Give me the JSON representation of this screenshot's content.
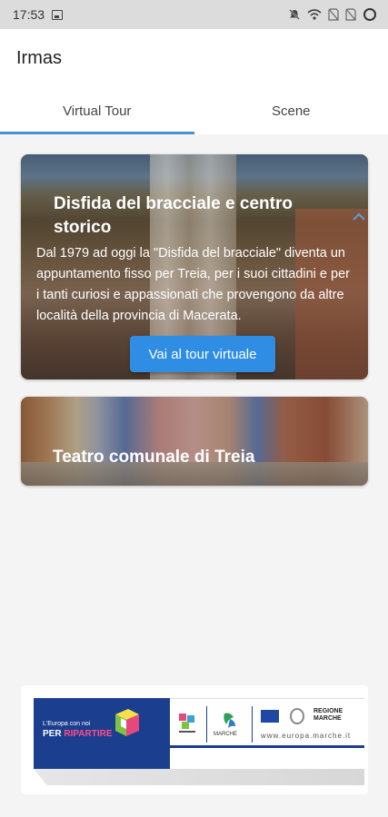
{
  "status_bar": {
    "time": "17:53",
    "icons": [
      "image-icon",
      "mute-icon",
      "hotspot-icon",
      "no-sim-icon",
      "no-sim-icon",
      "battery-ring-icon"
    ]
  },
  "app_bar": {
    "title": "Irmas"
  },
  "tabs": [
    {
      "label": "Virtual Tour",
      "active": true
    },
    {
      "label": "Scene",
      "active": false
    }
  ],
  "cards": [
    {
      "title": "Disfida del bracciale e centro storico",
      "description": "Dal 1979 ad oggi la \"Disfida del bracciale\" diventa un appuntamento fisso per Treia, per i suoi cittadini e per i tanti curiosi e appassionati che provengono da altre località della provincia di Macerata.",
      "button_label": "Vai al tour virtuale",
      "expanded": true
    },
    {
      "title": "Teatro comunale di Treia",
      "expanded": false
    }
  ],
  "banner": {
    "slogan_small": "L'Europa con noi",
    "slogan_big_1": "PER ",
    "slogan_big_2": "RIPARTIRE",
    "regione": "REGIONE MARCHE",
    "marche": "MARCHE",
    "url": "www.europa.marche.it"
  },
  "colors": {
    "accent": "#2f8de4",
    "tab_indicator": "#4a8fd6",
    "banner_blue": "#1c3e8f"
  }
}
